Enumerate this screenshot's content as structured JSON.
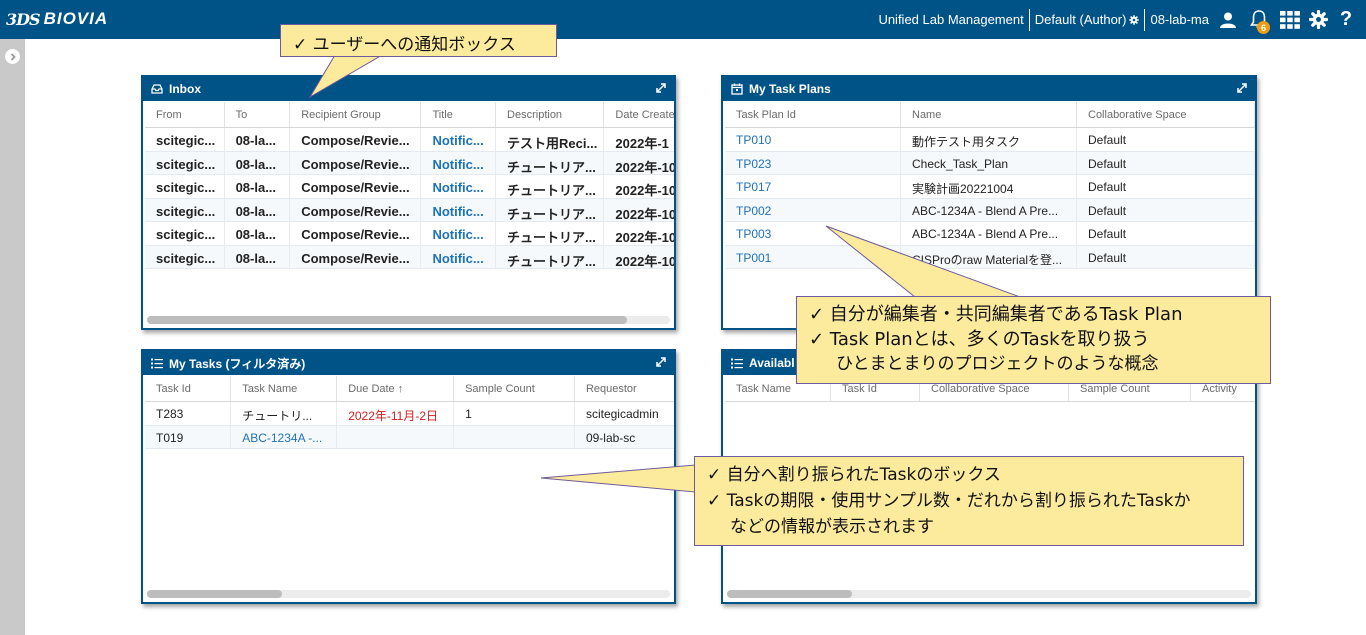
{
  "header": {
    "logo_mark": "3DS",
    "logo_text": "BIOVIA",
    "app_name": "Unified Lab Management",
    "role": "Default (Author)",
    "user": "08-lab-ma",
    "notification_count": "6"
  },
  "inbox": {
    "title": "Inbox",
    "columns": [
      "From",
      "To",
      "Recipient Group",
      "Title",
      "Description",
      "Date Create"
    ],
    "rows": [
      [
        "scitegic...",
        "08-la...",
        "Compose/Revie...",
        "Notific...",
        "テスト用Reci...",
        "2022年-1"
      ],
      [
        "scitegic...",
        "08-la...",
        "Compose/Revie...",
        "Notific...",
        "チュートリア...",
        "2022年-10"
      ],
      [
        "scitegic...",
        "08-la...",
        "Compose/Revie...",
        "Notific...",
        "チュートリア...",
        "2022年-10"
      ],
      [
        "scitegic...",
        "08-la...",
        "Compose/Revie...",
        "Notific...",
        "チュートリア...",
        "2022年-10"
      ],
      [
        "scitegic...",
        "08-la...",
        "Compose/Revie...",
        "Notific...",
        "チュートリア...",
        "2022年-10"
      ],
      [
        "scitegic...",
        "08-la...",
        "Compose/Revie...",
        "Notific...",
        "チュートリア...",
        "2022年-10"
      ]
    ]
  },
  "task_plans": {
    "title": "My Task Plans",
    "columns": [
      "Task Plan Id",
      "Name",
      "Collaborative Space"
    ],
    "rows": [
      [
        "TP010",
        "動作テスト用タスク",
        "Default"
      ],
      [
        "TP023",
        "Check_Task_Plan",
        "Default"
      ],
      [
        "TP017",
        "実験計画20221004",
        "Default"
      ],
      [
        "TP002",
        "ABC-1234A - Blend A Pre...",
        "Default"
      ],
      [
        "TP003",
        "ABC-1234A - Blend A Pre...",
        "Default"
      ],
      [
        "TP001",
        "CISProのraw Materialを登...",
        "Default"
      ]
    ]
  },
  "my_tasks": {
    "title": "My Tasks (フィルタ済み)",
    "columns": [
      "Task Id",
      "Task Name",
      "Due Date ↑",
      "Sample Count",
      "Requestor"
    ],
    "rows": [
      [
        "T283",
        "チュートリ...",
        "2022年-11月-2日",
        "1",
        "scitegicadmin"
      ],
      [
        "T019",
        "ABC-1234A -...",
        "",
        "",
        "09-lab-sc"
      ]
    ]
  },
  "available": {
    "title": "Availabl",
    "columns": [
      "Task Name",
      "Task Id",
      "Collaborative Space",
      "Sample Count",
      "Activity"
    ]
  },
  "callouts": {
    "inbox_note": "✓ ユーザーへの通知ボックス",
    "plans_note_1": "✓ 自分が編集者・共同編集者であるTask Plan",
    "plans_note_2": "✓ Task Planとは、多くのTaskを取り扱う",
    "plans_note_3": "ひとまとまりのプロジェクトのような概念",
    "tasks_note_1": "✓ 自分へ割り振られたTaskのボックス",
    "tasks_note_2": "✓ Taskの期限・使用サンプル数・だれから割り振られたTaskか",
    "tasks_note_3": "などの情報が表示されます"
  },
  "icons": {
    "user": "user-icon",
    "bell": "bell-icon",
    "apps": "grid-icon",
    "settings": "gear-icon",
    "help": "help-icon"
  }
}
